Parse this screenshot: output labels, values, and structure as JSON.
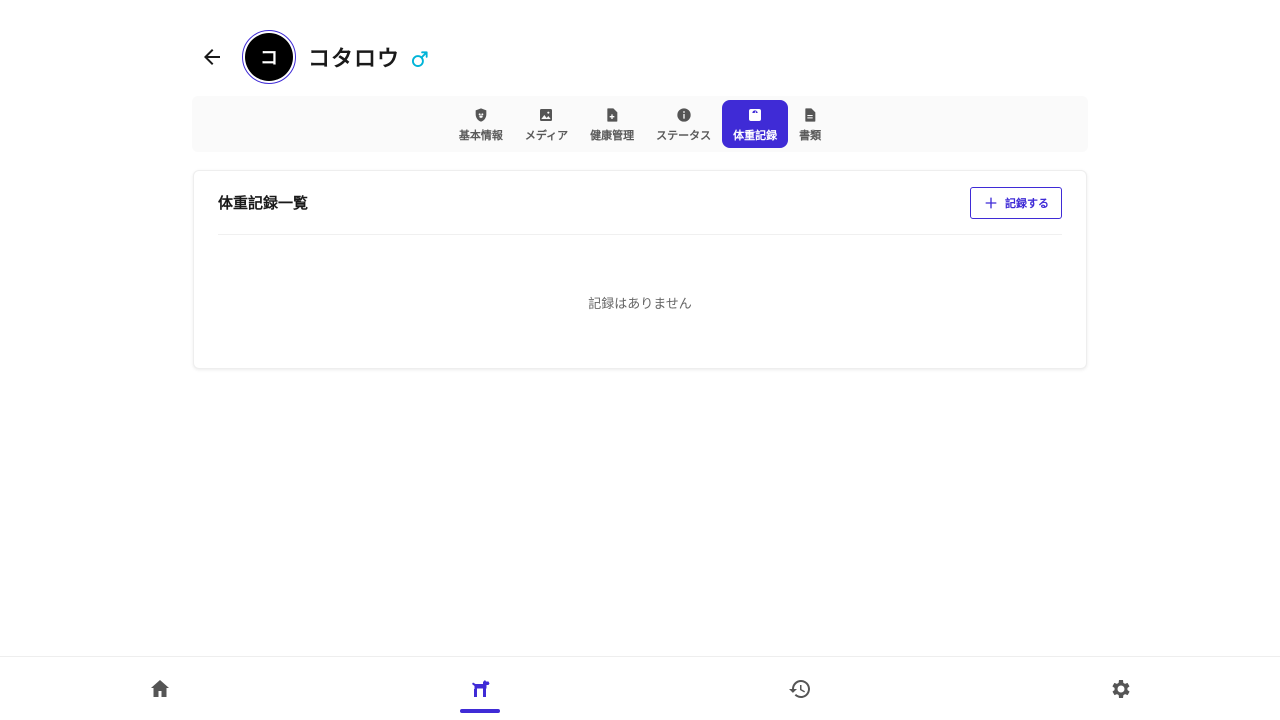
{
  "header": {
    "back_icon": "arrow-left-icon",
    "avatar_initial": "コ",
    "pet_name": "コタロウ",
    "gender_symbol": "♂",
    "gender_color": "#00b4d8"
  },
  "tabs": [
    {
      "label": "基本情報",
      "icon": "shield-paw-icon",
      "active": false
    },
    {
      "label": "メディア",
      "icon": "image-icon",
      "active": false
    },
    {
      "label": "健康管理",
      "icon": "medical-file-icon",
      "active": false
    },
    {
      "label": "ステータス",
      "icon": "info-icon",
      "active": false
    },
    {
      "label": "体重記録",
      "icon": "scale-icon",
      "active": true
    },
    {
      "label": "書類",
      "icon": "document-icon",
      "active": false
    }
  ],
  "weight_card": {
    "title": "体重記録一覧",
    "add_button_label": "記録する",
    "empty_message": "記録はありません"
  },
  "bottom_nav": [
    {
      "icon": "home-icon",
      "active": false
    },
    {
      "icon": "dog-icon",
      "active": true
    },
    {
      "icon": "history-icon",
      "active": false
    },
    {
      "icon": "gear-icon",
      "active": false
    }
  ],
  "colors": {
    "accent": "#3f2bd6",
    "icon_gray": "#555555",
    "male_blue": "#00b4d8"
  }
}
